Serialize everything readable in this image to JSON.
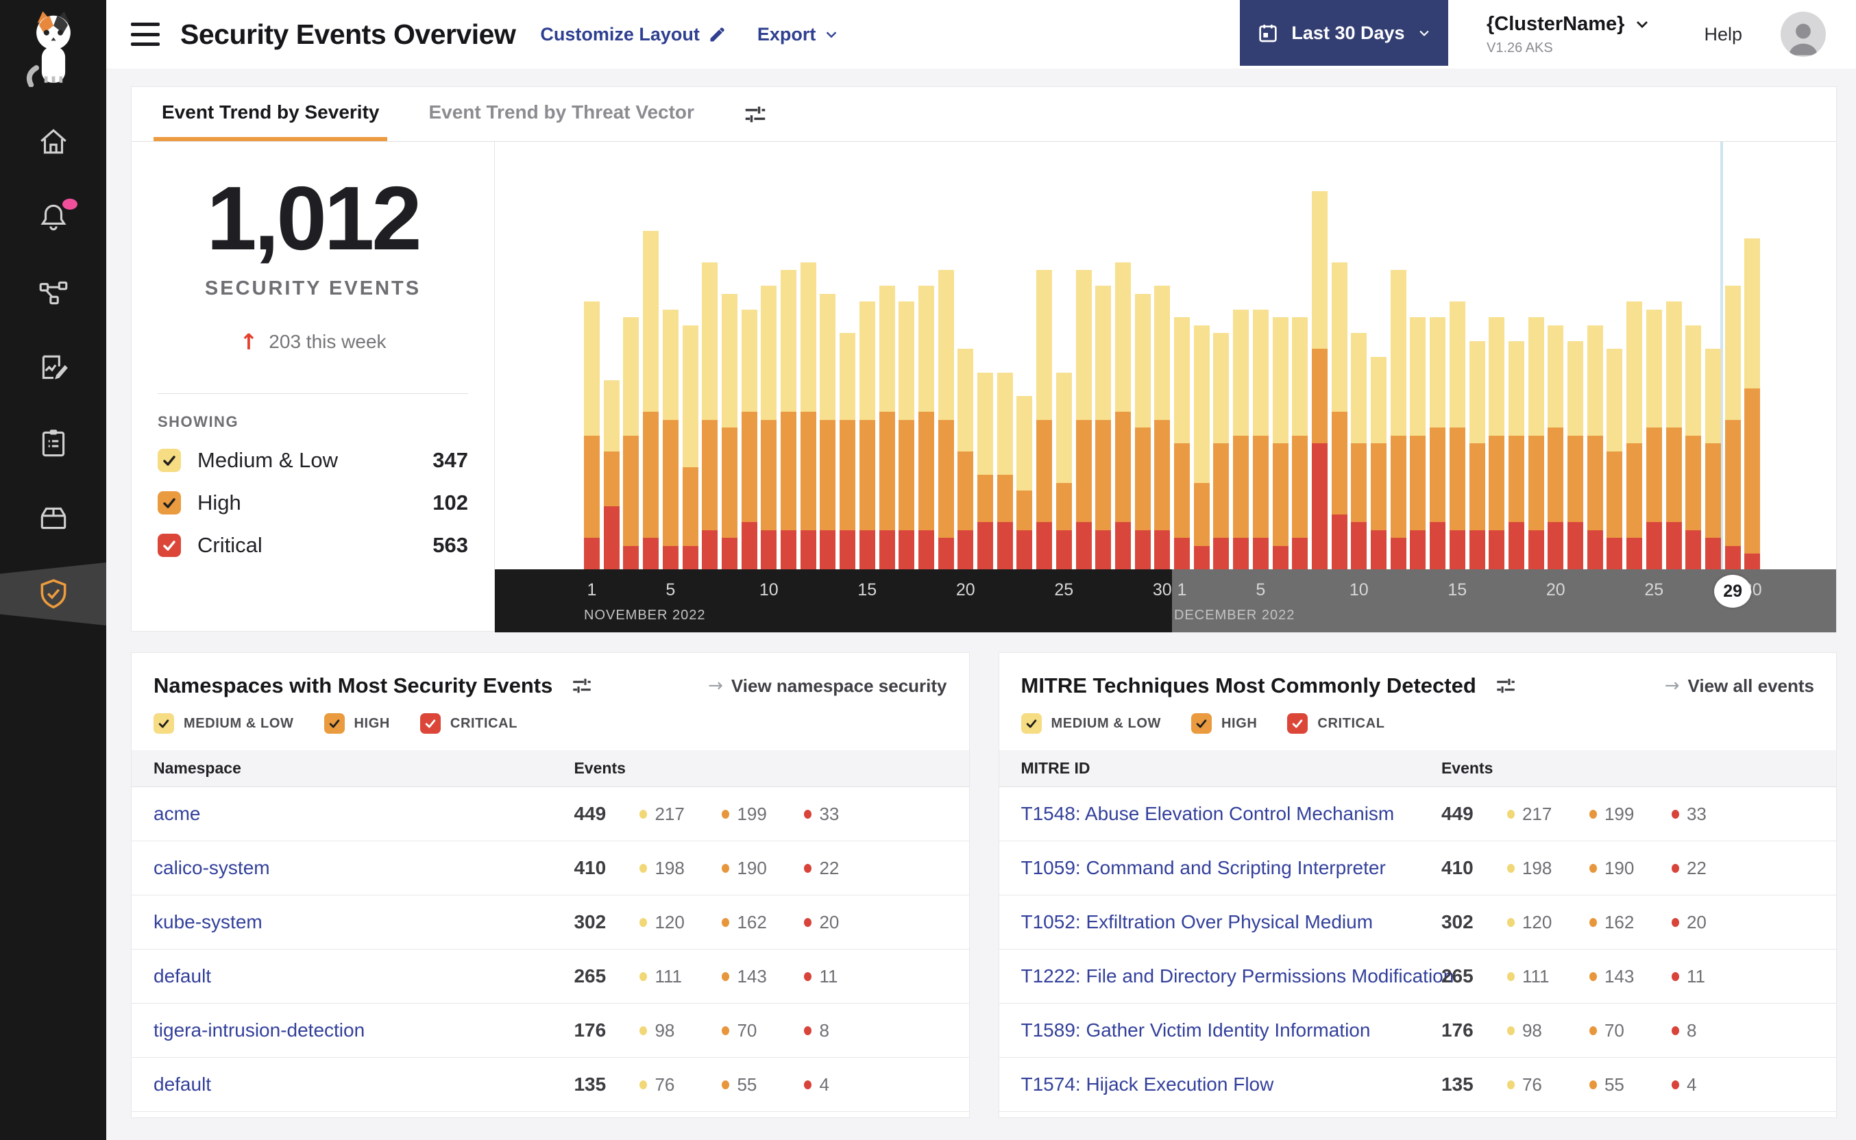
{
  "header": {
    "title": "Security Events Overview",
    "customize_layout_label": "Customize Layout",
    "export_label": "Export",
    "date_range_label": "Last 30 Days",
    "cluster_name": "{ClusterName}",
    "cluster_version": "V1.26 AKS",
    "help_label": "Help"
  },
  "sidebar": {
    "items": [
      "home",
      "alerts",
      "service-graph",
      "policy-edit",
      "compliance-reports",
      "inventory",
      "threat-defense"
    ],
    "active_item": "threat-defense"
  },
  "tabs": [
    {
      "label": "Event Trend by Severity",
      "active": true
    },
    {
      "label": "Event Trend by Threat Vector",
      "active": false
    }
  ],
  "severity_palette": [
    {
      "key": "medium",
      "label": "Medium & Low",
      "box": "#F6DC82",
      "check": "#1f1f1f",
      "dot": "#F1D775"
    },
    {
      "key": "high",
      "label": "High",
      "box": "#EA9A3F",
      "check": "#1f1f1f",
      "dot": "#E8963C"
    },
    {
      "key": "critical",
      "label": "Critical",
      "box": "#DB4639",
      "check": "#ffffff",
      "dot": "#D8433A"
    }
  ],
  "summary": {
    "total": "1,012",
    "subtitle": "SECURITY EVENTS",
    "delta": "203 this week",
    "showing_label": "SHOWING",
    "legend": [
      {
        "label": "Medium & Low",
        "count": "347",
        "checked": true
      },
      {
        "label": "High",
        "count": "102",
        "checked": true
      },
      {
        "label": "Critical",
        "count": "563",
        "checked": true
      }
    ]
  },
  "chart_data": {
    "type": "bar",
    "stacked": true,
    "title": "Event Trend by Severity",
    "x_unit": "day",
    "x_range": "Nov 1 2022 - Dec 30 2022",
    "ylim": [
      0,
      52
    ],
    "grid": false,
    "legend_position": "left",
    "months": [
      {
        "label": "NOVEMBER 2022",
        "start": 0,
        "days": 30,
        "ticks": [
          1,
          5,
          10,
          15,
          20,
          25,
          30
        ],
        "band_color": "#1B1B1B"
      },
      {
        "label": "DECEMBER 2022",
        "start": 30,
        "days": 30,
        "ticks": [
          1,
          5,
          10,
          15,
          20,
          25,
          30
        ],
        "band_color": "#6E6E6E"
      }
    ],
    "highlight": {
      "index": 58,
      "label": "29"
    },
    "series": [
      {
        "name": "Medium & Low",
        "color": "#F7E08F",
        "values": [
          17,
          9,
          15,
          23,
          14,
          18,
          20,
          17,
          13,
          17,
          18,
          19,
          16,
          11,
          15,
          16,
          15,
          16,
          19,
          13,
          13,
          13,
          12,
          19,
          14,
          19,
          17,
          19,
          17,
          17,
          16,
          20,
          14,
          16,
          16,
          16,
          15,
          20,
          19,
          14,
          11,
          21,
          15,
          14,
          16,
          13,
          15,
          12,
          15,
          13,
          12,
          14,
          13,
          18,
          15,
          16,
          14,
          12,
          17,
          19
        ]
      },
      {
        "name": "High",
        "color": "#EA9A43",
        "values": [
          13,
          7,
          14,
          16,
          16,
          10,
          14,
          14,
          14,
          14,
          15,
          15,
          14,
          14,
          14,
          15,
          14,
          15,
          15,
          10,
          6,
          6,
          5,
          13,
          6,
          13,
          14,
          14,
          13,
          14,
          12,
          8,
          12,
          13,
          13,
          13,
          13,
          12,
          13,
          10,
          11,
          13,
          12,
          12,
          13,
          11,
          12,
          11,
          12,
          12,
          11,
          12,
          11,
          12,
          12,
          12,
          12,
          12,
          16,
          21
        ]
      },
      {
        "name": "Critical",
        "color": "#D9473C",
        "values": [
          4,
          8,
          3,
          4,
          3,
          3,
          5,
          4,
          6,
          5,
          5,
          5,
          5,
          5,
          5,
          5,
          5,
          5,
          4,
          5,
          6,
          6,
          5,
          6,
          5,
          6,
          5,
          6,
          5,
          5,
          4,
          3,
          4,
          4,
          4,
          3,
          4,
          16,
          7,
          6,
          5,
          4,
          5,
          6,
          5,
          5,
          5,
          6,
          5,
          6,
          6,
          5,
          4,
          4,
          6,
          6,
          5,
          4,
          3,
          2
        ]
      }
    ]
  },
  "panels": {
    "namespaces": {
      "title": "Namespaces with Most Security Events",
      "link": "View namespace security",
      "filters": [
        "MEDIUM & LOW",
        "HIGH",
        "CRITICAL"
      ],
      "columns": [
        "Namespace",
        "Events"
      ],
      "rows": [
        {
          "name": "acme",
          "total": "449",
          "medium": "217",
          "high": "199",
          "critical": "33"
        },
        {
          "name": "calico-system",
          "total": "410",
          "medium": "198",
          "high": "190",
          "critical": "22"
        },
        {
          "name": "kube-system",
          "total": "302",
          "medium": "120",
          "high": "162",
          "critical": "20"
        },
        {
          "name": "default",
          "total": "265",
          "medium": "111",
          "high": "143",
          "critical": "11"
        },
        {
          "name": "tigera-intrusion-detection",
          "total": "176",
          "medium": "98",
          "high": "70",
          "critical": "8"
        },
        {
          "name": "default",
          "total": "135",
          "medium": "76",
          "high": "55",
          "critical": "4"
        }
      ]
    },
    "mitre": {
      "title": "MITRE Techniques Most Commonly Detected",
      "link": "View all events",
      "filters": [
        "MEDIUM & LOW",
        "HIGH",
        "CRITICAL"
      ],
      "columns": [
        "MITRE ID",
        "Events"
      ],
      "rows": [
        {
          "name": "T1548: Abuse Elevation Control Mechanism",
          "total": "449",
          "medium": "217",
          "high": "199",
          "critical": "33"
        },
        {
          "name": "T1059: Command and Scripting Interpreter",
          "total": "410",
          "medium": "198",
          "high": "190",
          "critical": "22"
        },
        {
          "name": "T1052: Exfiltration Over Physical Medium",
          "total": "302",
          "medium": "120",
          "high": "162",
          "critical": "20"
        },
        {
          "name": "T1222: File and Directory Permissions Modification",
          "total": "265",
          "medium": "111",
          "high": "143",
          "critical": "11"
        },
        {
          "name": "T1589: Gather Victim Identity Information",
          "total": "176",
          "medium": "98",
          "high": "70",
          "critical": "8"
        },
        {
          "name": "T1574: Hijack Execution Flow",
          "total": "135",
          "medium": "76",
          "high": "55",
          "critical": "4"
        }
      ]
    }
  }
}
